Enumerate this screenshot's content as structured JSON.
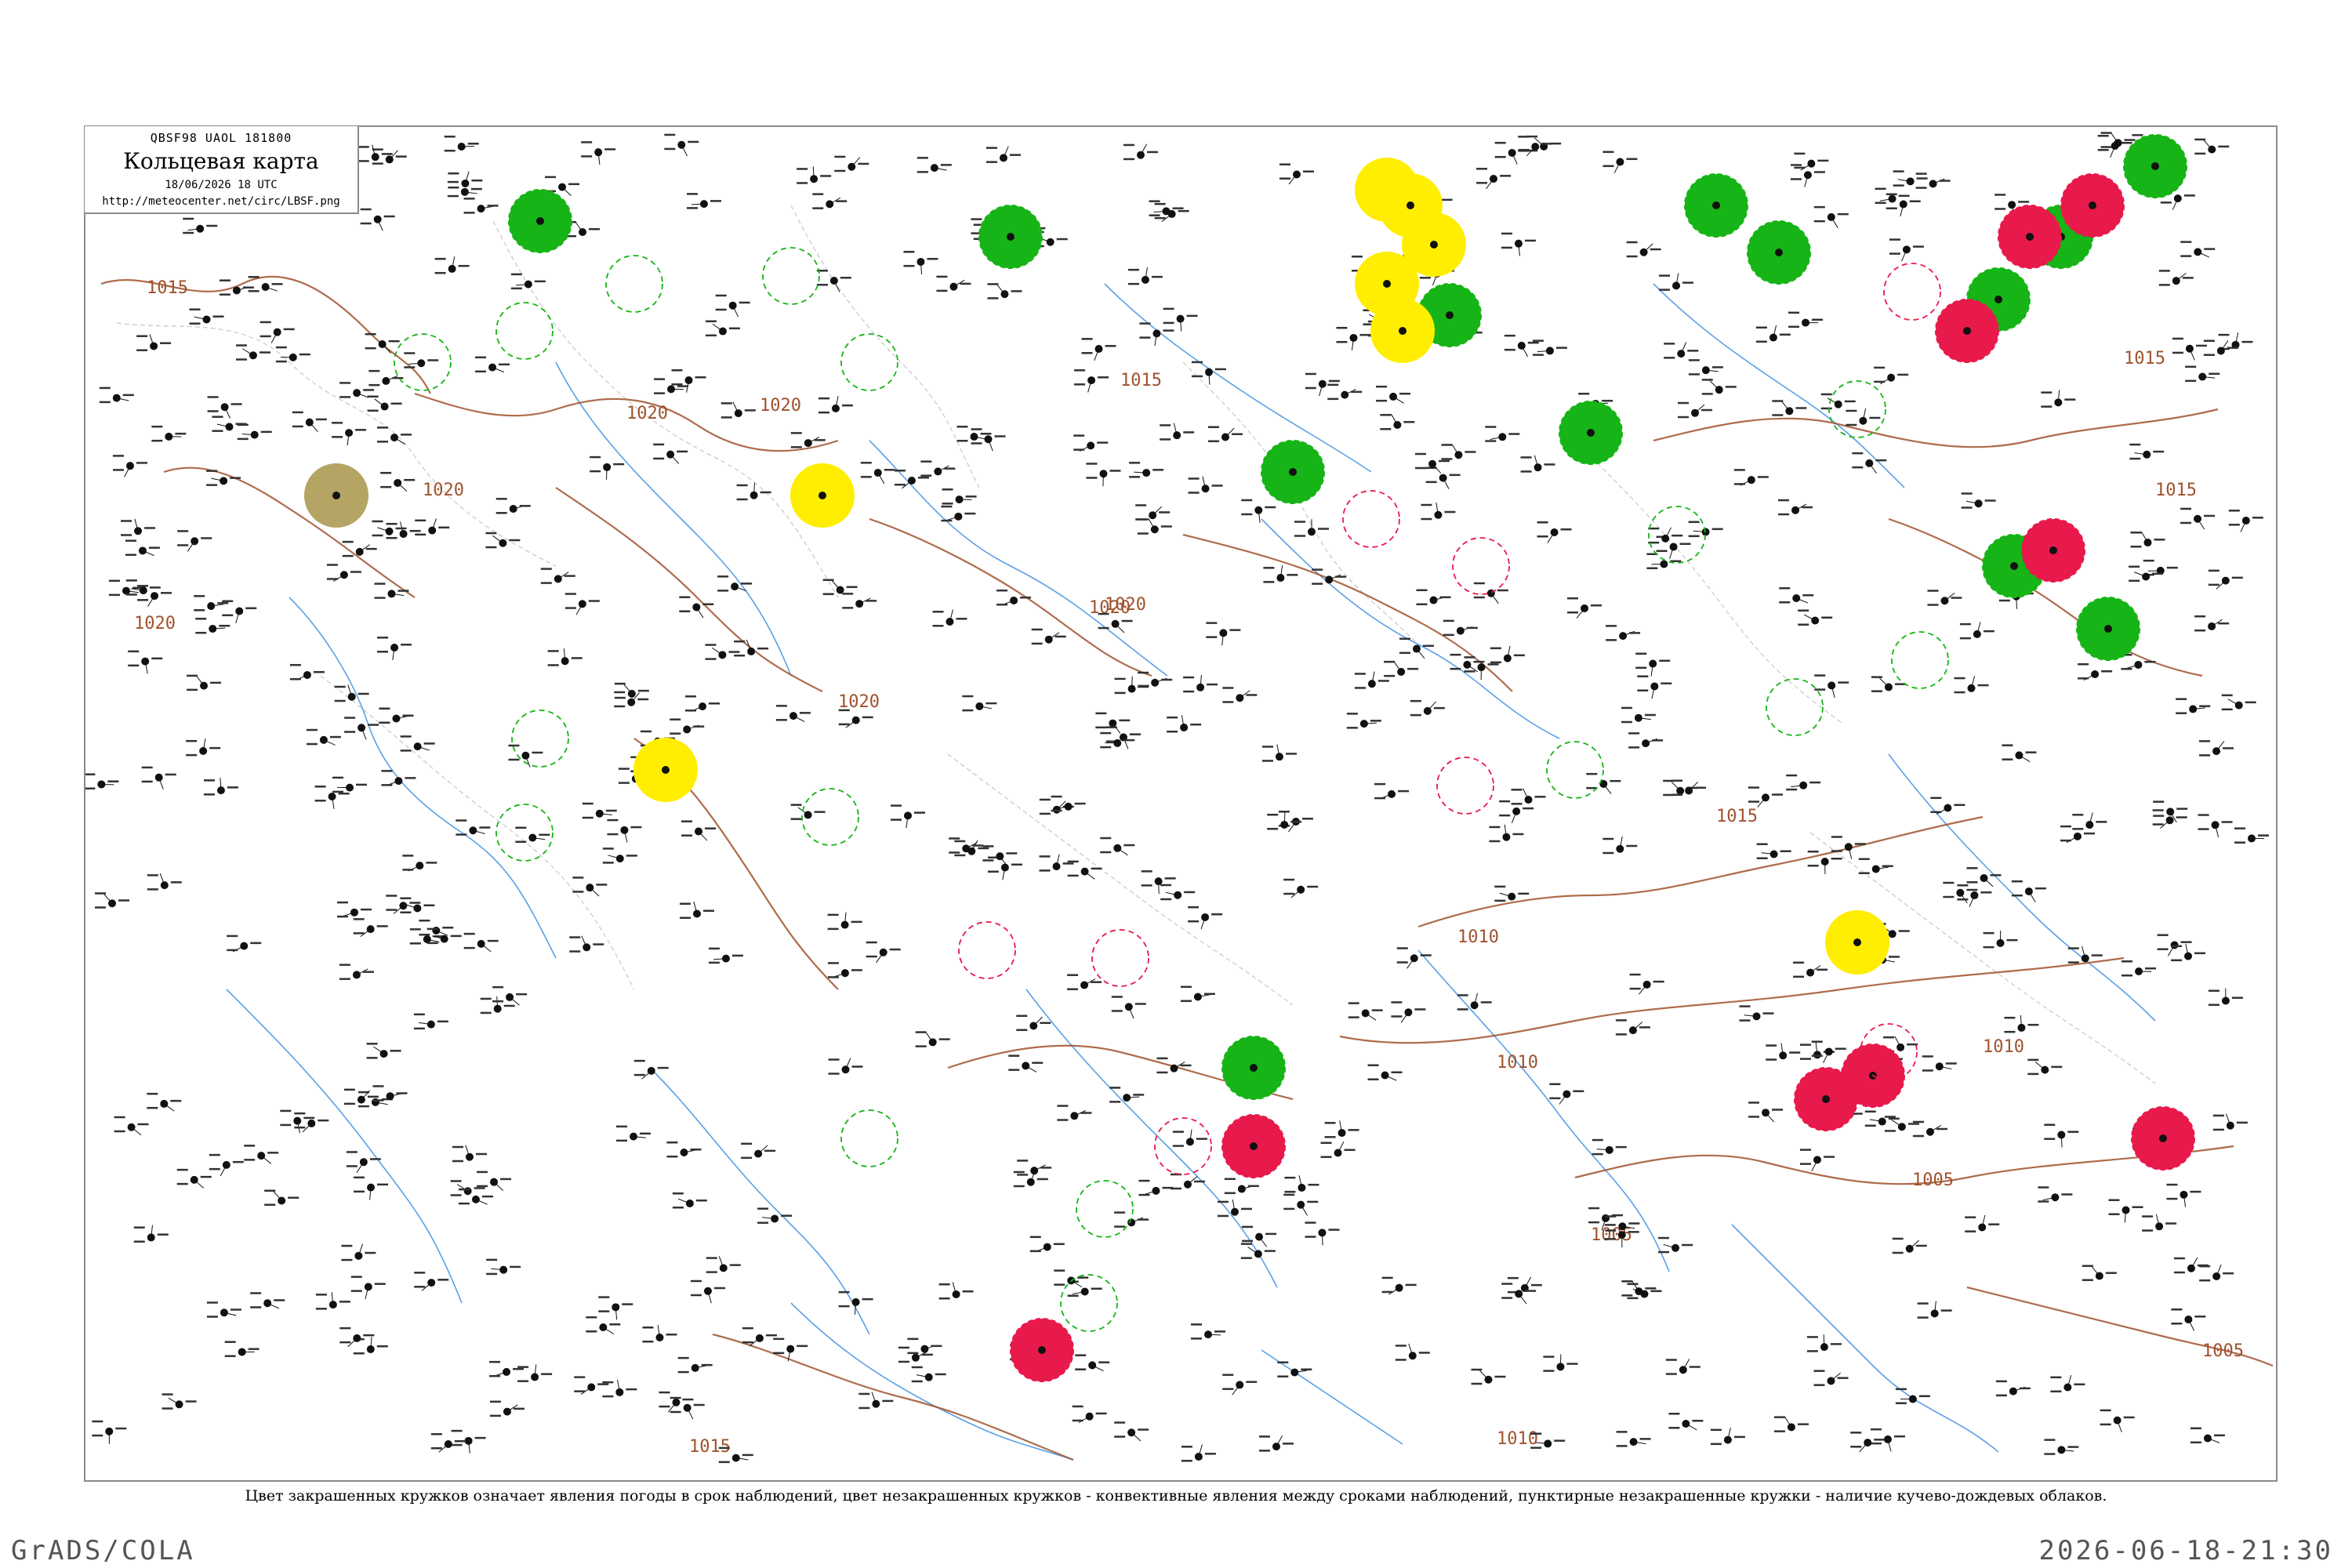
{
  "header": {
    "code": "QBSF98  UAOL  181800",
    "title": "Кольцевая карта",
    "time": "18/06/2026 18 UTC",
    "url": "http://meteocenter.net/circ/LBSF.png"
  },
  "caption": "Цвет закрашенных кружков означает явления погоды в срок наблюдений, цвет незакрашенных кружков - конвективные явления между сроками наблюдений, пунктирные незакрашенные кружки - наличие кучево-дождевых облаков.",
  "footer": {
    "left": "GrADS/COLA",
    "right": "2026-06-18-21:30"
  },
  "colors": {
    "green": "#16b416",
    "red": "#e8194b",
    "yellow": "#ffee00",
    "olive": "#b4a564",
    "isobar": "#a0522d",
    "river": "#5aa0e6"
  },
  "isobar_labels": [
    "1015",
    "1020",
    "1020",
    "1020",
    "1020",
    "1020",
    "1020",
    "1020",
    "1015",
    "1015",
    "1015",
    "1010",
    "1010",
    "1010",
    "1005",
    "1005",
    "1005",
    "1015",
    "1010",
    "1015"
  ],
  "filled_circles": [
    {
      "color": "green",
      "count": 14
    },
    {
      "color": "red",
      "count": 9
    },
    {
      "color": "yellow",
      "count": 8
    },
    {
      "color": "olive",
      "count": 1
    }
  ]
}
